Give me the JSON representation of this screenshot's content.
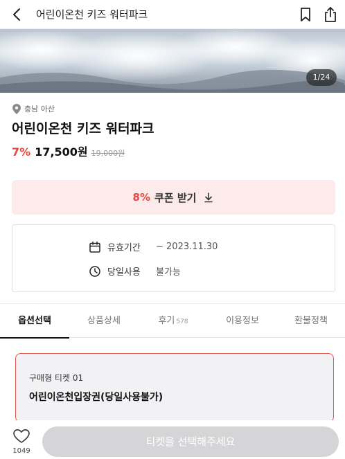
{
  "header": {
    "title": "어린이온천 키즈 워터파크"
  },
  "gallery": {
    "counter": "1/24"
  },
  "product": {
    "location": "충남 아산",
    "title": "어린이온천 키즈 워터파크",
    "discount_rate": "7%",
    "price": "17,500원",
    "original_price": "19,000원"
  },
  "coupon": {
    "rate": "8%",
    "label": "쿠폰 받기"
  },
  "info": {
    "validity_label": "유효기간",
    "validity_value": "~ 2023.11.30",
    "sameday_label": "당일사용",
    "sameday_value": "불가능"
  },
  "tabs": [
    {
      "label": "옵션선택"
    },
    {
      "label": "상품상세"
    },
    {
      "label": "후기",
      "count": "578"
    },
    {
      "label": "이용정보"
    },
    {
      "label": "환불정책"
    }
  ],
  "option": {
    "subtitle": "구매형 티켓 01",
    "name": "어린이온천입장권(당일사용불가)"
  },
  "bottom": {
    "like_count": "1049",
    "cta_label": "티켓을 선택해주세요"
  },
  "colors": {
    "accent": "#e8493f",
    "coupon_bg": "#fdeaea",
    "cta_disabled": "#d5d5d7"
  }
}
